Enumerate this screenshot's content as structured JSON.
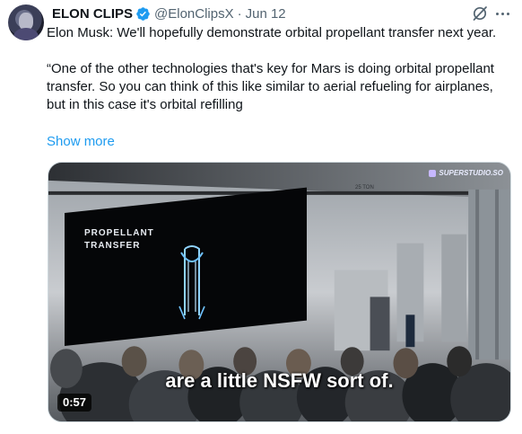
{
  "author": {
    "name": "ELON CLIPS",
    "handle": "@ElonClipsX",
    "separator": "·",
    "date": "Jun 12"
  },
  "tweet": {
    "line1": "Elon Musk: We'll hopefully demonstrate orbital propellant transfer next year.",
    "line2": "“One of the other technologies that's key for Mars is doing orbital propellant transfer. So you can think of this like similar to aerial refueling for airplanes, but in this case it's orbital refilling",
    "show_more": "Show more"
  },
  "video": {
    "screen_title": "PROPELLANT\nTRANSFER",
    "watermark": "SUPERSTUDIO.SO",
    "crane_label": "25 TON",
    "caption": "are a little NSFW sort of.",
    "duration": "0:57"
  },
  "colors": {
    "link": "#1d9bf0",
    "secondary_text": "#536471",
    "verified_badge": "#1d9bf0"
  },
  "icons": [
    "verified-badge-icon",
    "grok-icon",
    "more-options-icon"
  ]
}
